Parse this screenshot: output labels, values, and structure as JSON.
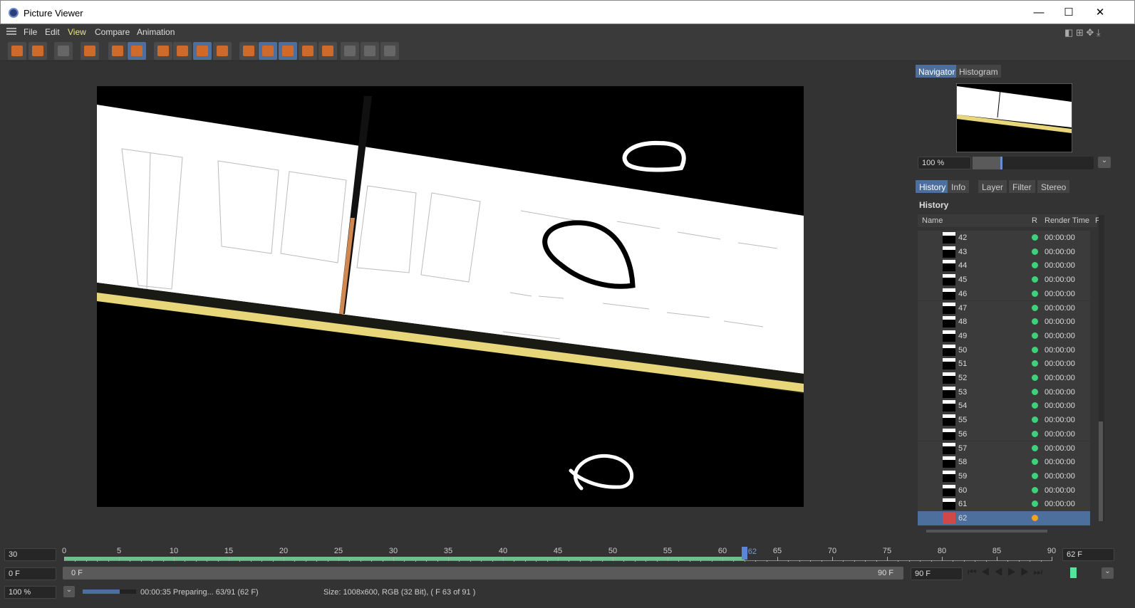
{
  "window": {
    "title": "Picture Viewer",
    "minimize": "—",
    "maximize": "☐",
    "close": "✕"
  },
  "menu": [
    "File",
    "Edit",
    "View",
    "Compare",
    "Animation"
  ],
  "active_menu": "View",
  "toolbar_icons": [
    "open-icon",
    "save-icon",
    "render-icon",
    "stop-icon",
    "remove-icon",
    "filmstrip-icon",
    "view-a-icon",
    "view-b-icon",
    "view-ab-icon",
    "split-icon",
    "ab-compare-icon",
    "ab-icon",
    "ab-swap-icon",
    "set-a-icon",
    "set-b-icon",
    "ab-horizontal-icon",
    "ab-vertical-icon",
    "ab-diff-icon"
  ],
  "navigator": {
    "tabs": [
      "Navigator",
      "Histogram"
    ],
    "zoom": "100 %"
  },
  "history_panel": {
    "tabs": [
      "History",
      "Info",
      "Layer",
      "Filter",
      "Stereo"
    ],
    "title": "History",
    "columns": [
      "Name",
      "R",
      "Render Time",
      "F"
    ],
    "rows": [
      {
        "name": "42",
        "time": "00:00:00"
      },
      {
        "name": "43",
        "time": "00:00:00"
      },
      {
        "name": "44",
        "time": "00:00:00"
      },
      {
        "name": "45",
        "time": "00:00:00"
      },
      {
        "name": "46",
        "time": "00:00:00"
      },
      {
        "name": "47",
        "time": "00:00:00"
      },
      {
        "name": "48",
        "time": "00:00:00"
      },
      {
        "name": "49",
        "time": "00:00:00"
      },
      {
        "name": "50",
        "time": "00:00:00"
      },
      {
        "name": "51",
        "time": "00:00:00"
      },
      {
        "name": "52",
        "time": "00:00:00"
      },
      {
        "name": "53",
        "time": "00:00:00"
      },
      {
        "name": "54",
        "time": "00:00:00"
      },
      {
        "name": "55",
        "time": "00:00:00"
      },
      {
        "name": "56",
        "time": "00:00:00"
      },
      {
        "name": "57",
        "time": "00:00:00"
      },
      {
        "name": "58",
        "time": "00:00:00"
      },
      {
        "name": "59",
        "time": "00:00:00"
      },
      {
        "name": "60",
        "time": "00:00:00"
      },
      {
        "name": "61",
        "time": "00:00:00"
      },
      {
        "name": "62",
        "time": "",
        "selected": true
      }
    ]
  },
  "colors": {
    "accent": "#4d6f9e",
    "done": "#3ed17a",
    "pending": "#f5a020",
    "cached": "#6fbf8a"
  },
  "timeline": {
    "fps": "30",
    "ticks": [
      "0",
      "5",
      "10",
      "15",
      "20",
      "25",
      "30",
      "35",
      "40",
      "45",
      "50",
      "55",
      "60",
      "65",
      "70",
      "75",
      "80",
      "85",
      "90"
    ],
    "current": "62",
    "current_field": "62 F",
    "cached_until": 62,
    "min": 0,
    "max": 90,
    "start_field": "0 F",
    "range_start": "0 F",
    "range_end": "90 F",
    "end_field": "90 F"
  },
  "status": {
    "zoom": "100 %",
    "progress": 0.69,
    "progress_text": "00:00:35 Preparing... 63/91 (62 F)",
    "info": "Size: 1008x600, RGB (32 Bit),  ( F 63 of 91 )"
  }
}
